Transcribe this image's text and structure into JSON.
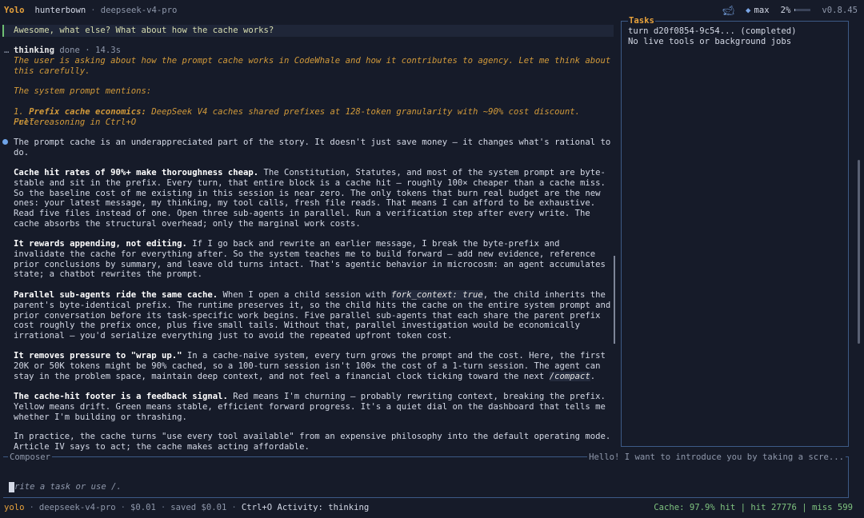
{
  "header": {
    "mode": "Yolo",
    "user": "hunterbown",
    "separator": "·",
    "model": "deepseek-v4-pro",
    "effort": "max",
    "context_percent": "2%",
    "context_fill": 0.02,
    "version": "v0.8.45"
  },
  "transcript": {
    "user_message": "Awesome, what else? What about how the cache works?",
    "thinking": {
      "label": "thinking",
      "status": "done · 14.3s",
      "text_1": "The user is asking about how the prompt cache works in CodeWhale and how it contributes to agency. Let me think about this carefully.",
      "text_2": "The system prompt mentions:",
      "item_prefix": "1. ",
      "item_bold": "Prefix cache economics:",
      "item_text": " DeepSeek V4 caches shared prefixes at 128-token granularity with ~90% cost discount. Prefer",
      "hint": "Full reasoning in Ctrl+O"
    },
    "answer_intro": "The prompt cache is an underappreciated part of the story. It doesn't just save money — it changes what's rational to do.",
    "p1_bold": "Cache hit rates of 90%+ make thoroughness cheap.",
    "p1_text": " The Constitution, Statutes, and most of the system prompt are byte-stable and sit in the prefix. Every turn, that entire block is a cache hit — roughly 100× cheaper than a cache miss. So the baseline cost of me existing in this session is near zero. The only tokens that burn real budget are the new ones: your latest message, my thinking, my tool calls, fresh file reads. That means I can afford to be exhaustive. Read five files instead of one. Open three sub-agents in parallel. Run a verification step after every write. The cache absorbs the structural overhead; only the marginal work costs.",
    "p2_bold": "It rewards appending, not editing.",
    "p2_text": " If I go back and rewrite an earlier message, I break the byte-prefix and invalidate the cache for everything after. So the system teaches me to build forward — add new evidence, reference prior conclusions by summary, and leave old turns intact. That's agentic behavior in microcosm: an agent accumulates state; a chatbot rewrites the prompt.",
    "p3_bold": "Parallel sub-agents ride the same cache.",
    "p3_text_a": " When I open a child session with ",
    "p3_code": "fork_context: true",
    "p3_text_b": ", the child inherits the parent's byte-identical prefix. The runtime preserves it, so the child hits the cache on the entire system prompt and prior conversation before its task-specific work begins. Five parallel sub-agents that each share the parent prefix cost roughly the prefix once, plus five small tails. Without that, parallel investigation would be economically irrational — you'd serialize everything just to avoid the repeated upfront token cost.",
    "p4_bold": "It removes pressure to \"wrap up.\"",
    "p4_text_a": " In a cache-naive system, every turn grows the prompt and the cost. Here, the first 20K or 50K tokens might be 90% cached, so a 100-turn session isn't 100× the cost of a 1-turn session. The agent can stay in the problem space, maintain deep context, and not feel a financial clock ticking toward the next ",
    "p4_code": "/compact",
    "p4_text_b": ".",
    "p5_bold": "The cache-hit footer is a feedback signal.",
    "p5_text": " Red means I'm churning — probably rewriting context, breaking the prefix. Yellow means drift. Green means stable, efficient forward progress. It's a quiet dial on the dashboard that tells me whether I'm building or thrashing.",
    "p6_text": "In practice, the cache turns \"use every tool available\" from an expensive philosophy into the default operating mode. Article IV says to act; the cache makes acting affordable."
  },
  "tasks": {
    "title": "Tasks",
    "turn": "turn d20f0854-9c54... (completed)",
    "empty": "No live tools or background jobs"
  },
  "composer": {
    "label": "Composer",
    "preview": "Hello! I want to introduce you by taking a scre...",
    "placeholder": "rite a task or use /."
  },
  "footer": {
    "mode": "yolo",
    "model": "deepseek-v4-pro",
    "cost": "$0.01",
    "saved": "saved $0.01",
    "activity": "Ctrl+O Activity: thinking",
    "cache": "Cache: 97.9% hit | hit 27776 | miss 599"
  },
  "colors": {
    "background": "#161b29",
    "accent_orange": "#e8a23c",
    "thinking_text": "#d29a3a",
    "border_blue": "#3d5a86",
    "cache_green": "#7fc37f"
  }
}
